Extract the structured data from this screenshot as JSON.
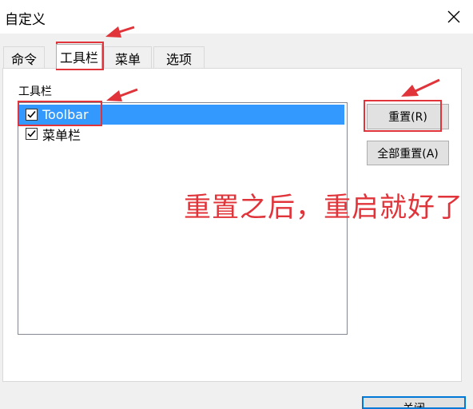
{
  "window": {
    "title": "自定义",
    "close_icon": "close-icon"
  },
  "tabs": [
    {
      "label": "命令",
      "active": false
    },
    {
      "label": "工具栏",
      "active": true
    },
    {
      "label": "菜单",
      "active": false
    },
    {
      "label": "选项",
      "active": false
    }
  ],
  "toolbar_panel": {
    "group_label": "工具栏",
    "items": [
      {
        "label": "Toolbar",
        "checked": true,
        "selected": true
      },
      {
        "label": "菜单栏",
        "checked": true,
        "selected": false
      }
    ]
  },
  "buttons": {
    "reset": "重置(R)",
    "reset_all": "全部重置(A)",
    "close": "关闭"
  },
  "annotation": {
    "text": "重置之后，重启就好了",
    "color": "#e0343a"
  },
  "colors": {
    "selection": "#3399ff",
    "dialog_bg": "#f0f0f0",
    "accent_border": "#0078d7"
  }
}
